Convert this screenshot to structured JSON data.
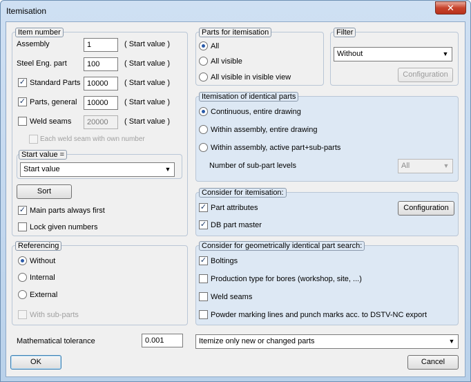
{
  "window": {
    "title": "Itemisation",
    "close_glyph": "✕"
  },
  "item_number": {
    "legend": "Item number",
    "rows": [
      {
        "label": "Assembly",
        "value": "1",
        "suffix": "( Start value )",
        "checkbox": false
      },
      {
        "label": "Steel Eng. part",
        "value": "100",
        "suffix": "( Start value )",
        "checkbox": false
      },
      {
        "label": "Standard Parts",
        "value": "10000",
        "suffix": "( Start value )",
        "checkbox": true,
        "checked": true
      },
      {
        "label": "Parts, general",
        "value": "10000",
        "suffix": "( Start value )",
        "checkbox": true,
        "checked": true
      },
      {
        "label": "Weld seams",
        "value": "20000",
        "suffix": "( Start value )",
        "checkbox": true,
        "checked": false,
        "disabled_input": true
      }
    ],
    "each_weld_seam": "Each weld seam with own number",
    "start_value_group": {
      "legend": "Start value =",
      "selected": "Start value"
    },
    "sort_button": "Sort",
    "main_parts_first": {
      "label": "Main parts always first",
      "checked": true
    },
    "lock_given": {
      "label": "Lock given numbers",
      "checked": false
    }
  },
  "referencing": {
    "legend": "Referencing",
    "options": [
      "Without",
      "Internal",
      "External"
    ],
    "selected": 0,
    "with_sub_parts": "With sub-parts"
  },
  "tolerance": {
    "label": "Mathematical tolerance",
    "value": "0.001"
  },
  "parts_for_itemisation": {
    "legend": "Parts for itemisation",
    "options": [
      "All",
      "All visible",
      "All visible in visible view"
    ],
    "selected": 0
  },
  "filter": {
    "legend": "Filter",
    "selected": "Without",
    "config_button": "Configuration"
  },
  "identical_parts": {
    "legend": "Itemisation of identical parts",
    "options": [
      "Continuous, entire drawing",
      "Within assembly, entire drawing",
      "Within assembly,  active part+sub-parts"
    ],
    "selected": 0,
    "levels_label": "Number of sub-part levels",
    "levels_value": "All"
  },
  "consider": {
    "legend": "Consider for itemisation:",
    "items": [
      {
        "label": "Part attributes",
        "checked": true
      },
      {
        "label": "DB part master",
        "checked": true
      }
    ],
    "config_button": "Configuration"
  },
  "geom": {
    "legend": "Consider for geometrically identical part search:",
    "items": [
      {
        "label": "Boltings",
        "checked": true
      },
      {
        "label": "Production type for bores (workshop, site, ...)",
        "checked": false
      },
      {
        "label": "Weld seams",
        "checked": false
      },
      {
        "label": "Powder marking lines and punch marks acc. to DSTV-NC export",
        "checked": false
      }
    ]
  },
  "itemize_select": "Itemize only new or changed parts",
  "ok_button": "OK",
  "cancel_button": "Cancel",
  "glyphs": {
    "check": "✓",
    "arrow": "▼"
  }
}
